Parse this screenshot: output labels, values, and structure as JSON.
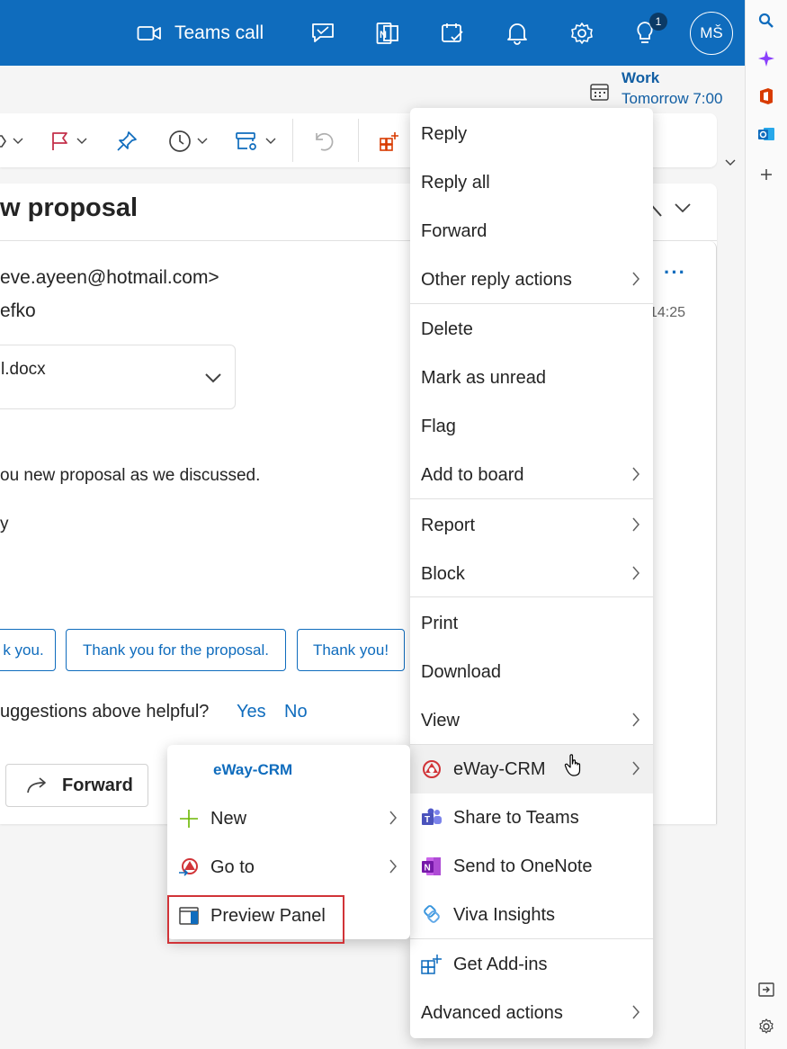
{
  "topbar": {
    "teams_call_label": "Teams call",
    "notification_count": "1",
    "avatar_initials": "MŠ",
    "accent_color": "#0f6cbd"
  },
  "reminder": {
    "title": "Work",
    "time": "Tomorrow 7:00"
  },
  "email": {
    "subject": "w proposal",
    "from": "eve.ayeen@hotmail.com>",
    "to": "efko",
    "attachment_name": "l.docx",
    "body_line1": "ou new proposal as we discussed.",
    "body_line2": "y",
    "time": "14:25"
  },
  "suggestions": [
    "k you.",
    "Thank you for the proposal.",
    "Thank you!"
  ],
  "feedback": {
    "question": "uggestions above helpful?",
    "yes": "Yes",
    "no": "No"
  },
  "forward_button_label": "Forward",
  "context_menu": {
    "items": [
      {
        "label": "Reply"
      },
      {
        "label": "Reply all"
      },
      {
        "label": "Forward"
      },
      {
        "label": "Other reply actions",
        "submenu": true
      },
      {
        "label": "Delete"
      },
      {
        "label": "Mark as unread"
      },
      {
        "label": "Flag"
      },
      {
        "label": "Add to board",
        "submenu": true
      },
      {
        "label": "Report",
        "submenu": true
      },
      {
        "label": "Block",
        "submenu": true
      },
      {
        "label": "Print"
      },
      {
        "label": "Download"
      },
      {
        "label": "View",
        "submenu": true
      },
      {
        "label": "eWay-CRM",
        "submenu": true,
        "highlighted": true
      },
      {
        "label": "Share to Teams"
      },
      {
        "label": "Send to OneNote"
      },
      {
        "label": "Viva Insights"
      },
      {
        "label": "Get Add-ins"
      },
      {
        "label": "Advanced actions",
        "submenu": true
      }
    ]
  },
  "eway_submenu": {
    "header": "eWay-CRM",
    "items": [
      {
        "label": "New",
        "submenu": true
      },
      {
        "label": "Go to",
        "submenu": true
      },
      {
        "label": "Preview Panel",
        "highlighted_box": true
      }
    ]
  }
}
